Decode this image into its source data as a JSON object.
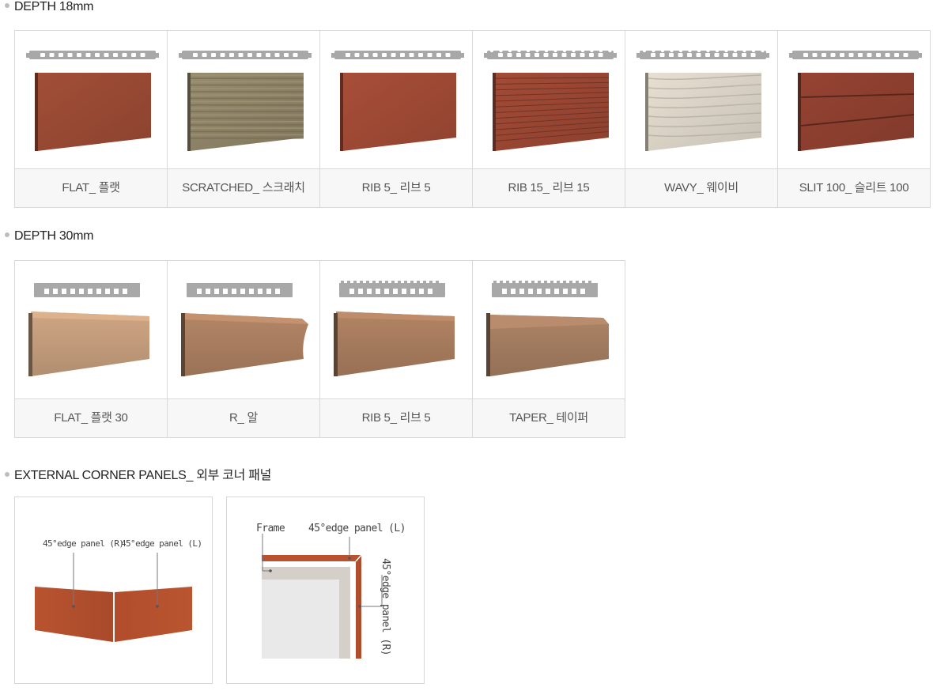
{
  "sections": {
    "depth18": {
      "title": "DEPTH 18mm",
      "items": [
        {
          "label": "FLAT_ 플랫",
          "finish": "flat",
          "color": "#9a4a34"
        },
        {
          "label": "SCRATCHED_ 스크래치",
          "finish": "scratched",
          "color": "#8f8468"
        },
        {
          "label": "RIB 5_ 리브 5",
          "finish": "flat",
          "color": "#a04a35"
        },
        {
          "label": "RIB 15_ 리브 15",
          "finish": "rib",
          "color": "#9b4733"
        },
        {
          "label": "WAVY_ 웨이비",
          "finish": "wavy",
          "color": "#dcd5c8"
        },
        {
          "label": "SLIT 100_ 슬리트 100",
          "finish": "slit",
          "color": "#8f4030"
        }
      ]
    },
    "depth30": {
      "title": "DEPTH 30mm",
      "items": [
        {
          "label": "FLAT_ 플랫 30",
          "finish": "flat",
          "color": "#c09a7a"
        },
        {
          "label": "R_ 알",
          "finish": "r",
          "color": "#a77c5f"
        },
        {
          "label": "RIB 5_ 리브 5",
          "finish": "rib5",
          "color": "#a57a5c"
        },
        {
          "label": "TAPER_ 테이퍼",
          "finish": "taper",
          "color": "#a07a5e"
        }
      ]
    },
    "corner": {
      "title": "EXTERNAL CORNER PANELS_ 외부 코너 패널",
      "left_label_r": "45°edge panel (R)",
      "left_label_l": "45°edge panel (L)",
      "right_label_frame": "Frame",
      "right_label_l": "45°edge panel (L)",
      "right_label_r": "45°edge panel (R)"
    }
  },
  "colors": {
    "profile_gray": "#a8a8a8",
    "terracotta": "#b8522f",
    "frame_gray": "#d4cfc9"
  }
}
